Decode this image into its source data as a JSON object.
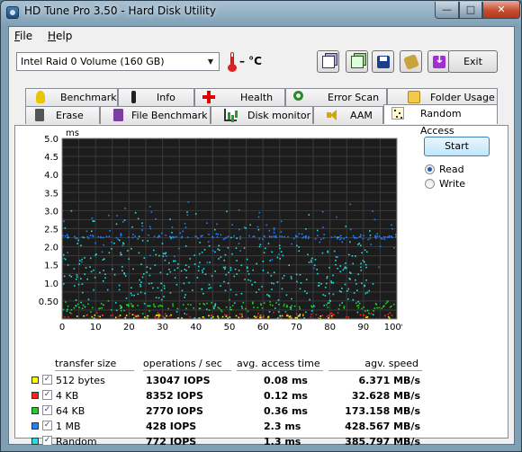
{
  "window": {
    "title": "HD Tune Pro 3.50 - Hard Disk Utility"
  },
  "caption_buttons": {
    "minimize": "—",
    "maximize": "□",
    "close": "✕"
  },
  "menu": {
    "file_mnemonic": "F",
    "file_rest": "ile",
    "help_mnemonic": "H",
    "help_rest": "elp"
  },
  "toolbar": {
    "drive": "Intel   Raid 0 Volume (160 GB)",
    "temperature": "– °C",
    "exit_label": "Exit",
    "buttons": [
      "copy-text-icon",
      "copy-info-icon",
      "save-icon",
      "screenshot-icon",
      "options-icon"
    ]
  },
  "tabs_top": [
    {
      "label": "Benchmark",
      "icon": "benchmark-icon"
    },
    {
      "label": "Info",
      "icon": "info-icon"
    },
    {
      "label": "Health",
      "icon": "health-icon"
    },
    {
      "label": "Error Scan",
      "icon": "error-scan-icon"
    },
    {
      "label": "Folder Usage",
      "icon": "folder-usage-icon"
    }
  ],
  "tabs_bottom": [
    {
      "label": "Erase",
      "icon": "erase-icon"
    },
    {
      "label": "File Benchmark",
      "icon": "file-benchmark-icon"
    },
    {
      "label": "Disk monitor",
      "icon": "disk-monitor-icon"
    },
    {
      "label": "AAM",
      "icon": "aam-icon"
    },
    {
      "label": "Random Access",
      "icon": "random-access-icon",
      "active": true
    }
  ],
  "controls": {
    "start_label": "Start",
    "read_label": "Read",
    "write_label": "Write",
    "selected_mode": "Read"
  },
  "chart_data": {
    "type": "scatter",
    "ylabel": "ms",
    "ylim": [
      0,
      5.0
    ],
    "xlim": [
      0,
      100
    ],
    "y_ticks": [
      "5.0",
      "4.5",
      "4.0",
      "3.5",
      "3.0",
      "2.5",
      "2.0",
      "1.5",
      "1.0",
      "0.50"
    ],
    "x_ticks": [
      "0",
      "10",
      "20",
      "30",
      "40",
      "50",
      "60",
      "70",
      "80",
      "90",
      "100%"
    ],
    "grid": true,
    "background": "#1c1c1c",
    "series": [
      {
        "name": "512 bytes",
        "color": "#ffff00",
        "approx_access_ms": 0.08
      },
      {
        "name": "4 KB",
        "color": "#ff2020",
        "approx_access_ms": 0.12
      },
      {
        "name": "64 KB",
        "color": "#20d020",
        "approx_access_ms": 0.36
      },
      {
        "name": "1 MB",
        "color": "#2080ff",
        "approx_access_ms": 2.3
      },
      {
        "name": "Random",
        "color": "#20e0e0",
        "approx_access_ms": 1.3
      }
    ]
  },
  "results": {
    "headers": [
      "transfer size",
      "operations / sec",
      "avg. access time",
      "agv. speed"
    ],
    "rows": [
      {
        "size": "512 bytes",
        "ops": "13047 IOPS",
        "access": "0.08 ms",
        "speed": "6.371 MB/s",
        "color": "#ffff00",
        "checked": true
      },
      {
        "size": "4 KB",
        "ops": "8352 IOPS",
        "access": "0.12 ms",
        "speed": "32.628 MB/s",
        "color": "#ff2020",
        "checked": true
      },
      {
        "size": "64 KB",
        "ops": "2770 IOPS",
        "access": "0.36 ms",
        "speed": "173.158 MB/s",
        "color": "#20d020",
        "checked": true
      },
      {
        "size": "1 MB",
        "ops": "428 IOPS",
        "access": "2.3 ms",
        "speed": "428.567 MB/s",
        "color": "#2080ff",
        "checked": true
      },
      {
        "size": "Random",
        "ops": "772 IOPS",
        "access": "1.3 ms",
        "speed": "385.797 MB/s",
        "color": "#20e0e0",
        "checked": true
      }
    ],
    "check_mark": "✓"
  }
}
